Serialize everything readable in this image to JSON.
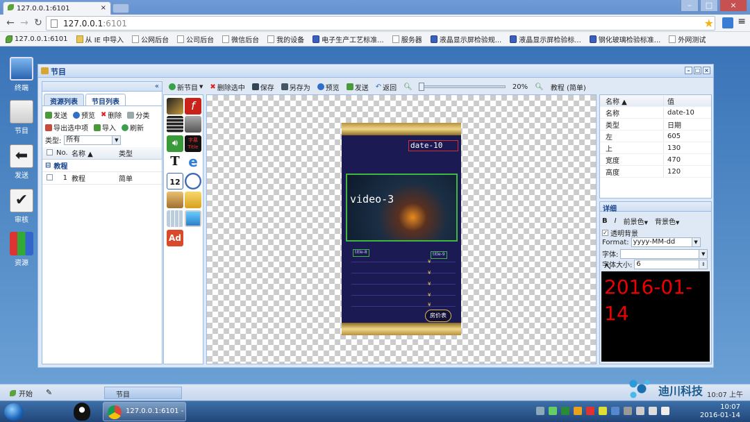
{
  "browser": {
    "tab_title": "127.0.0.1:6101",
    "url_host": "127.0.0.1",
    "url_port": ":6101",
    "bookmarks": [
      {
        "label": "127.0.0.1:6101",
        "icon": "leaf-icon"
      },
      {
        "label": "从 IE 中导入",
        "icon": "folder-icon"
      },
      {
        "label": "公网后台",
        "icon": "page-icon"
      },
      {
        "label": "公司后台",
        "icon": "page-icon"
      },
      {
        "label": "微信后台",
        "icon": "page-icon"
      },
      {
        "label": "我的设备",
        "icon": "page-icon"
      },
      {
        "label": "电子生产工艺标准...",
        "icon": "paw-icon"
      },
      {
        "label": "服务器",
        "icon": "page-icon"
      },
      {
        "label": "液晶显示屏检验规...",
        "icon": "paw-icon"
      },
      {
        "label": "液晶显示屏检验标...",
        "icon": "paw-icon"
      },
      {
        "label": "钢化玻璃检验标准...",
        "icon": "paw-icon"
      },
      {
        "label": "外网测试",
        "icon": "page-icon"
      }
    ]
  },
  "desktop_icons": [
    {
      "label": "终端",
      "name": "terminal"
    },
    {
      "label": "节目",
      "name": "program"
    },
    {
      "label": "发送",
      "name": "send"
    },
    {
      "label": "审核",
      "name": "review"
    },
    {
      "label": "资源",
      "name": "resource"
    }
  ],
  "window": {
    "title": "节目"
  },
  "left_panel": {
    "tabs": [
      "资源列表",
      "节目列表"
    ],
    "toolbar1": [
      "发送",
      "预览",
      "删除",
      "分类"
    ],
    "toolbar2": [
      "导出选中项",
      "导入",
      "刷新"
    ],
    "type_label": "类型:",
    "type_value": "所有",
    "columns": {
      "no": "No.",
      "name": "名称 ▲",
      "type": "类型"
    },
    "group": "教程",
    "rows": [
      {
        "no": "1",
        "name": "教程",
        "type": "简单"
      }
    ]
  },
  "center_toolbar": {
    "new": "新节目",
    "delete": "删除选中",
    "save": "保存",
    "save_as": "另存为",
    "preview": "预览",
    "send": "发送",
    "back": "返回",
    "zoom": "20%",
    "program_name": "教程 (简单)"
  },
  "canvas": {
    "date_label": "date-10",
    "video_label": "video-3",
    "title_left": "title-8",
    "title_right": "title-9",
    "yen": "¥",
    "price_button": "房价表"
  },
  "properties": {
    "col_name": "名称 ▲",
    "col_value": "值",
    "rows": [
      {
        "k": "名称",
        "v": "date-10"
      },
      {
        "k": "类型",
        "v": "日期"
      },
      {
        "k": "左",
        "v": "605"
      },
      {
        "k": "上",
        "v": "130"
      },
      {
        "k": "宽度",
        "v": "470"
      },
      {
        "k": "高度",
        "v": "120"
      }
    ]
  },
  "detail": {
    "title": "详细",
    "bold": "B",
    "italic": "I",
    "fg": "前景色",
    "bg": "背景色",
    "transparent": "透明背景",
    "format_label": "Format:",
    "format_value": "yyyy-MM-dd",
    "font_label": "字体:",
    "font_value": "",
    "size_label": "字体大小:",
    "size_value": "6",
    "preview_text": "2016-01-14"
  },
  "app_bar": {
    "start": "开始",
    "task": "节目",
    "brand": "迪川科技",
    "time": "10:07 上午"
  },
  "taskbar": {
    "chrome_item": "127.0.0.1:6101 - ...",
    "time": "10:07",
    "date": "2016-01-14"
  },
  "colors": {
    "accent": "#15428b",
    "border": "#99bbe8",
    "preview_text": "#e00000"
  }
}
